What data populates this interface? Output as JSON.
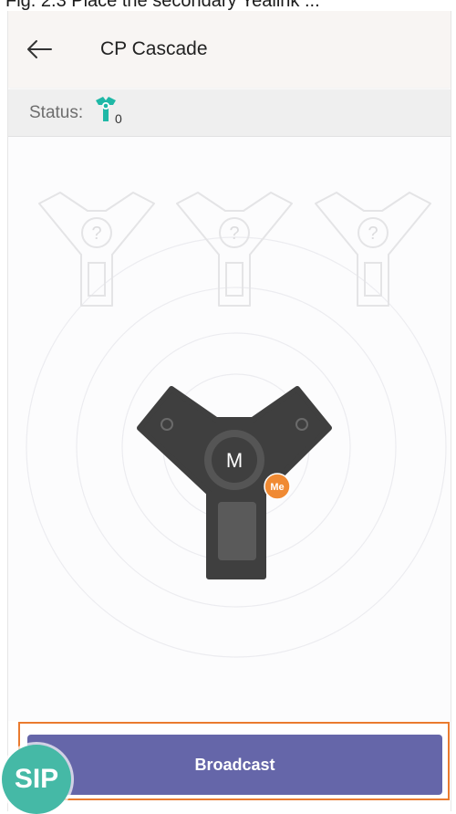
{
  "header": {
    "top_caption": "Fig. 2.3 Place the secondary Yealink ...",
    "title": "CP Cascade"
  },
  "status": {
    "label": "Status:",
    "count": "0"
  },
  "devices": {
    "unknown_placeholder": "?",
    "main_device_label": "M",
    "me_badge": "Me"
  },
  "actions": {
    "broadcast_label": "Broadcast"
  },
  "watermark": {
    "text": "SIP"
  },
  "colors": {
    "accent_button": "#6566a9",
    "highlight_border": "#ea7b2f",
    "status_icon": "#1fb8a6",
    "me_badge": "#f08a33",
    "device_body": "#3f3f3f"
  },
  "icons": {
    "back": "arrow-left-icon",
    "status": "conference-phone-icon",
    "placeholder_device": "unknown-conference-phone-icon",
    "main_device": "conference-phone-icon"
  }
}
